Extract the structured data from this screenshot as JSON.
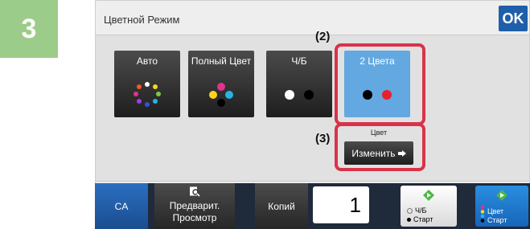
{
  "step_number": "3",
  "dialog": {
    "title": "Цветной Режим",
    "ok_label": "OK",
    "modes": [
      {
        "label": "Авто",
        "selected": false
      },
      {
        "label": "Полный Цвет",
        "selected": false
      },
      {
        "label": "Ч/Б",
        "selected": false
      },
      {
        "label": "2 Цвета",
        "selected": true
      }
    ],
    "callouts": {
      "modes": "(2)",
      "change": "(3)"
    },
    "change_group_label": "Цвет",
    "change_button_label": "Изменить"
  },
  "bottom_bar": {
    "ca_label": "CA",
    "preview_line1": "Предварит.",
    "preview_line2": "Просмотр",
    "copies_label": "Копий",
    "copies_value": "1",
    "bw_start_line1": "Ч/Б",
    "bw_start_line2": "Старт",
    "color_start_line1": "Цвет",
    "color_start_line2": "Старт"
  },
  "colors": {
    "step_badge": "#9ccc8a",
    "ok_button": "#1f5faa",
    "selected_mode": "#63a8e0",
    "highlight": "#d8334a",
    "color_start": "#1b7fd4",
    "ca_button": "#2367b6"
  },
  "icons": {
    "preview": "magnifier-document-icon",
    "start": "diamond-start-icon",
    "change_arrow": "arrow-right-icon"
  }
}
